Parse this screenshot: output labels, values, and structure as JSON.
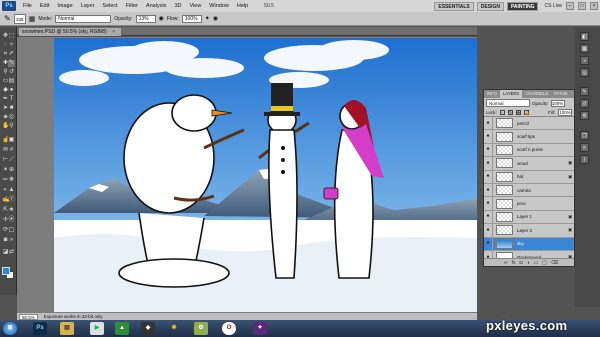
{
  "menubar": {
    "app_logo": "Ps",
    "items": [
      "File",
      "Edit",
      "Image",
      "Layer",
      "Select",
      "Filter",
      "Analysis",
      "3D",
      "View",
      "Window",
      "Help"
    ],
    "zoom_readout": "50.5",
    "workspaces": [
      "ESSENTIALS",
      "DESIGN",
      "PAINTING"
    ],
    "active_workspace": "PAINTING",
    "cslive": "CS Live"
  },
  "optionsbar": {
    "brush_size": "335",
    "mode_label": "Mode:",
    "mode_value": "Normal",
    "opacity_label": "Opacity:",
    "opacity_value": "13%",
    "flow_label": "Flow:",
    "flow_value": "100%"
  },
  "document": {
    "tab_title": "snowmen.PSD @ 50.5% (sky, RGB/8)",
    "close": "×"
  },
  "layers_panel": {
    "tabs": [
      "INFO",
      "LAYERS",
      "CHANNELS",
      "PATHS"
    ],
    "active_tab": "LAYERS",
    "blend_mode": "Normal",
    "opacity_label": "Opacity:",
    "opacity_value": "100%",
    "lock_label": "Lock:",
    "fill_label": "Fill:",
    "fill_value": "100%",
    "layers": [
      {
        "name": "pencil",
        "selected": false,
        "thumb": "checker",
        "locked": false
      },
      {
        "name": "scarf tips",
        "selected": false,
        "thumb": "checker",
        "locked": false
      },
      {
        "name": "scarf n purse",
        "selected": false,
        "thumb": "checker",
        "locked": false
      },
      {
        "name": "wood",
        "selected": false,
        "thumb": "checker",
        "locked": true
      },
      {
        "name": "hat",
        "selected": false,
        "thumb": "checker",
        "locked": true
      },
      {
        "name": "carrots",
        "selected": false,
        "thumb": "checker",
        "locked": false
      },
      {
        "name": "prov",
        "selected": false,
        "thumb": "checker",
        "locked": false
      },
      {
        "name": "Layer 1",
        "selected": false,
        "thumb": "checker",
        "locked": true
      },
      {
        "name": "Layer 2",
        "selected": false,
        "thumb": "checker",
        "locked": true
      },
      {
        "name": "sky",
        "selected": true,
        "thumb": "sky",
        "locked": false
      },
      {
        "name": "Background",
        "selected": false,
        "thumb": "white",
        "locked": true
      }
    ]
  },
  "statusbar": {
    "zoom": "50.5%",
    "message": "Exposure works in 32-bit only"
  },
  "watermark": "pxleyes.com",
  "colors": {
    "foreground": "#1b8fd8",
    "background": "#ffffff",
    "selection": "#3a86d4"
  }
}
